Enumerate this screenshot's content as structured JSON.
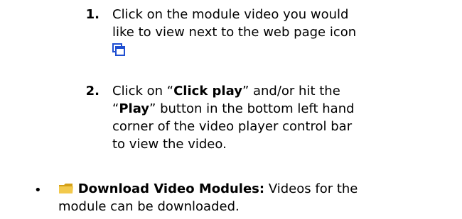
{
  "steps": [
    {
      "number": "1.",
      "lines": [
        "Click on the module video you would",
        "like to view next to the web page icon"
      ],
      "icon": "web-page-icon"
    },
    {
      "number": "2.",
      "line1_prefix": "Click on  “",
      "line1_bold": "Click play",
      "line1_suffix": "” and/or hit the",
      "line2_prefix": "“",
      "line2_bold": "Play",
      "line2_suffix": "” button in the bottom left hand",
      "line3": "corner of the video player control bar",
      "line4": "to view the video."
    }
  ],
  "bullet": {
    "symbol": "•",
    "icon": "folder-icon",
    "title": "Download Video Modules:",
    "text_line1": " Videos for the",
    "text_line2": "module can be downloaded."
  },
  "colors": {
    "folder": "#f2c94c",
    "folder_dark": "#d4a017",
    "page_icon": "#1f4fd1"
  }
}
